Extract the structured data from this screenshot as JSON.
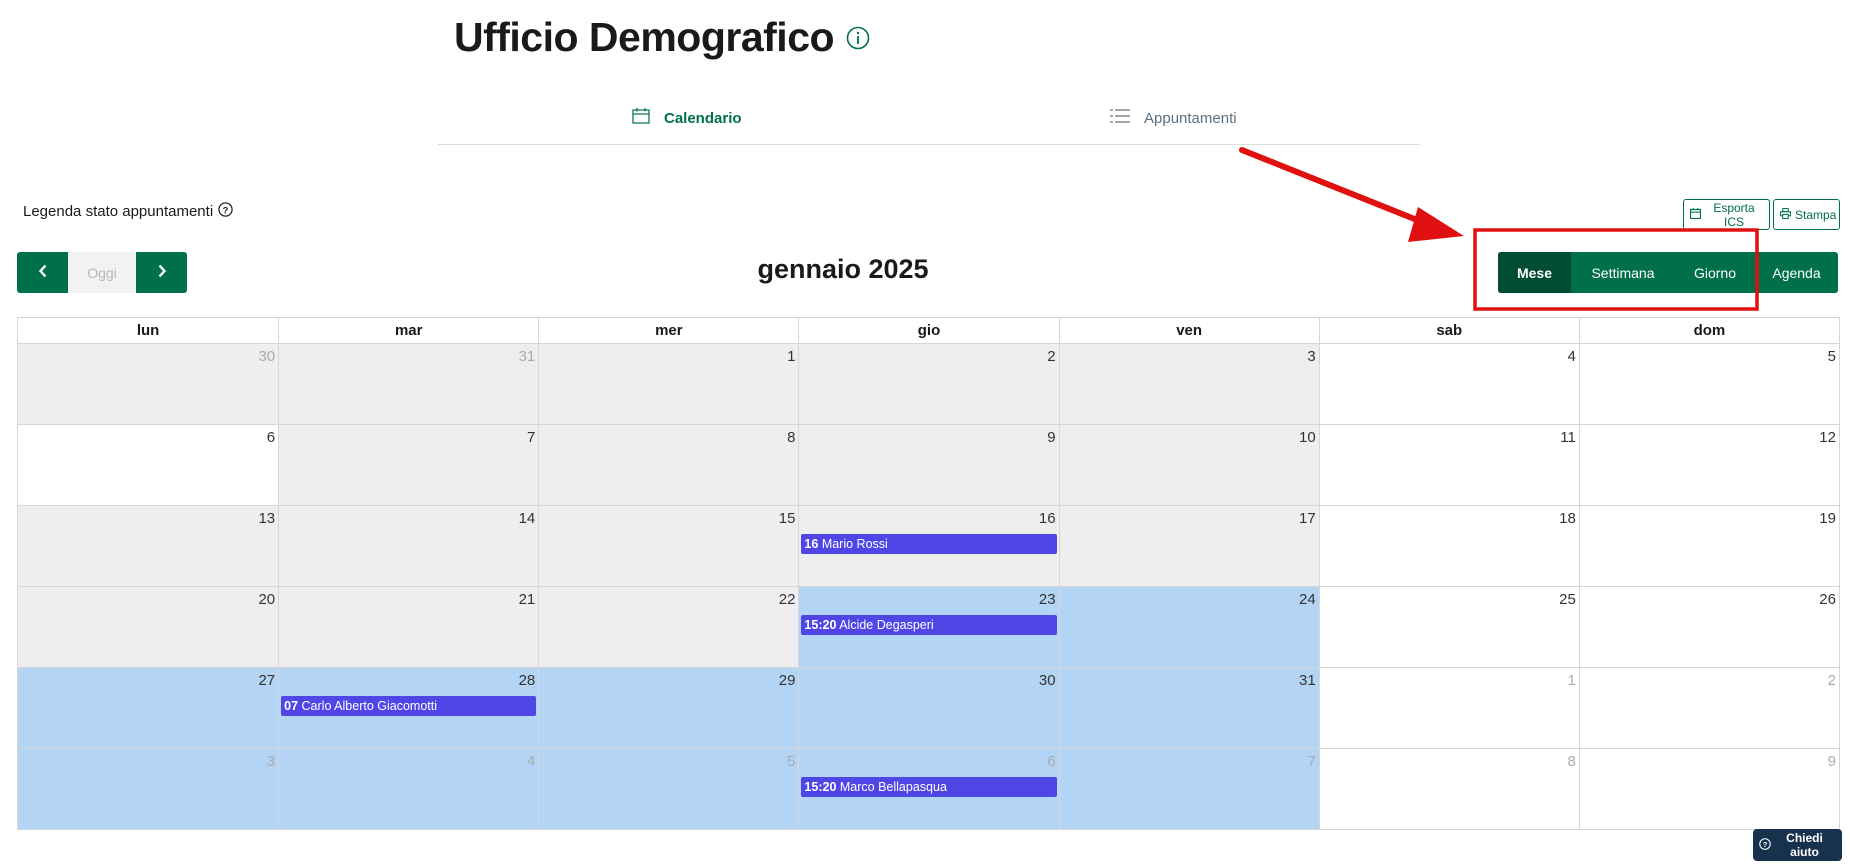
{
  "header": {
    "title": "Ufficio Demografico",
    "info_icon": "info-circle-icon"
  },
  "tabs": [
    {
      "label": "Calendario",
      "icon": "calendar-icon",
      "active": true
    },
    {
      "label": "Appuntamenti",
      "icon": "list-icon",
      "active": false
    }
  ],
  "legend": {
    "label": "Legenda stato appuntamenti",
    "icon": "question-circle-icon"
  },
  "toolbar": {
    "export_label": "Esporta ICS",
    "print_label": "Stampa",
    "today_label": "Oggi"
  },
  "calendar": {
    "month_title": "gennaio 2025",
    "views": [
      {
        "label": "Mese",
        "active": true
      },
      {
        "label": "Settimana",
        "active": false
      },
      {
        "label": "Giorno",
        "active": false
      },
      {
        "label": "Agenda",
        "active": false
      }
    ],
    "weekdays": [
      "lun",
      "mar",
      "mer",
      "gio",
      "ven",
      "sab",
      "dom"
    ],
    "weeks": [
      [
        {
          "day": "30",
          "other": true,
          "bg": "grey"
        },
        {
          "day": "31",
          "other": true,
          "bg": "grey"
        },
        {
          "day": "1",
          "bg": "grey"
        },
        {
          "day": "2",
          "bg": "grey"
        },
        {
          "day": "3",
          "bg": "grey"
        },
        {
          "day": "4",
          "bg": "white"
        },
        {
          "day": "5",
          "bg": "white"
        }
      ],
      [
        {
          "day": "6",
          "bg": "white"
        },
        {
          "day": "7",
          "bg": "grey"
        },
        {
          "day": "8",
          "bg": "grey"
        },
        {
          "day": "9",
          "bg": "grey"
        },
        {
          "day": "10",
          "bg": "grey"
        },
        {
          "day": "11",
          "bg": "white"
        },
        {
          "day": "12",
          "bg": "white"
        }
      ],
      [
        {
          "day": "13",
          "bg": "grey"
        },
        {
          "day": "14",
          "bg": "grey"
        },
        {
          "day": "15",
          "bg": "grey"
        },
        {
          "day": "16",
          "bg": "grey",
          "event": {
            "time": "16",
            "name": "Mario Rossi"
          }
        },
        {
          "day": "17",
          "bg": "grey"
        },
        {
          "day": "18",
          "bg": "white"
        },
        {
          "day": "19",
          "bg": "white"
        }
      ],
      [
        {
          "day": "20",
          "bg": "grey"
        },
        {
          "day": "21",
          "bg": "grey"
        },
        {
          "day": "22",
          "bg": "grey"
        },
        {
          "day": "23",
          "bg": "blue",
          "event": {
            "time": "15:20",
            "name": "Alcide Degasperi"
          }
        },
        {
          "day": "24",
          "bg": "blue"
        },
        {
          "day": "25",
          "bg": "white"
        },
        {
          "day": "26",
          "bg": "white"
        }
      ],
      [
        {
          "day": "27",
          "bg": "blue"
        },
        {
          "day": "28",
          "bg": "blue",
          "event": {
            "time": "07",
            "name": "Carlo Alberto Giacomotti"
          }
        },
        {
          "day": "29",
          "bg": "blue"
        },
        {
          "day": "30",
          "bg": "blue"
        },
        {
          "day": "31",
          "bg": "blue"
        },
        {
          "day": "1",
          "other": true,
          "bg": "white"
        },
        {
          "day": "2",
          "other": true,
          "bg": "white"
        }
      ],
      [
        {
          "day": "3",
          "other": true,
          "bg": "blue"
        },
        {
          "day": "4",
          "other": true,
          "bg": "blue"
        },
        {
          "day": "5",
          "other": true,
          "bg": "blue"
        },
        {
          "day": "6",
          "other": true,
          "bg": "blue",
          "event": {
            "time": "15:20",
            "name": "Marco Bellapasqua"
          }
        },
        {
          "day": "7",
          "other": true,
          "bg": "blue"
        },
        {
          "day": "8",
          "other": true,
          "bg": "white"
        },
        {
          "day": "9",
          "other": true,
          "bg": "white"
        }
      ]
    ]
  },
  "help": {
    "label": "Chiedi aiuto",
    "icon": "question-circle-icon"
  },
  "colors": {
    "brand": "#00704a",
    "brand_dark": "#004d33",
    "event": "#5046e5",
    "highlight_range": "#b3d4f5",
    "past_day": "#eeeeee",
    "annotation": "#e01010",
    "help_button": "#17324d"
  }
}
